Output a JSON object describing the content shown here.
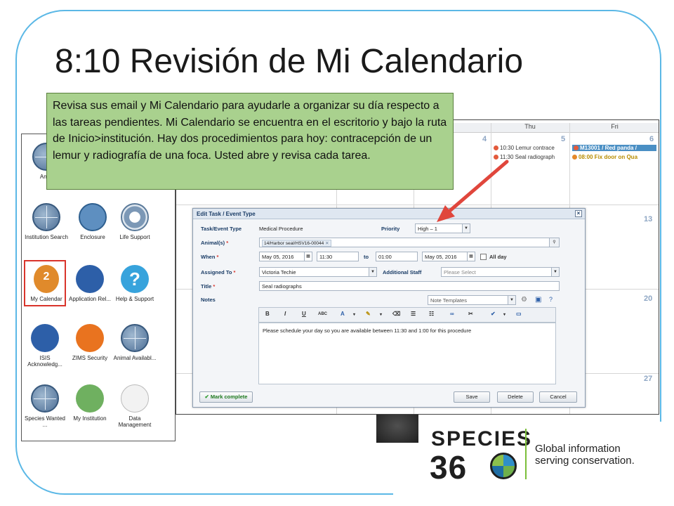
{
  "slide": {
    "title": "8:10 Revisión de Mi Calendario",
    "callout_text": "Revisa sus email y Mi Calendario para ayudarle a organizar su día respecto a las tareas pendientes. Mi Calendario se encuentra en el escritorio y bajo la ruta de Inicio>institución.  Hay dos procedimientos para hoy: contracepción de un lemur y radiografía de una foca. Usted abre y revisa cada tarea."
  },
  "colors": {
    "frame": "#5bb8e6",
    "callout_bg": "#a9d18e",
    "highlight_border": "#d9342b",
    "arrow": "#e0463c",
    "logo_bar": "#7bbf3a"
  },
  "desktop_icons": [
    {
      "label": "Anim",
      "icon": "globe-icon"
    },
    {
      "label": "Institution Search",
      "icon": "globe-icon"
    },
    {
      "label": "Enclosure",
      "icon": "enclosure-icon"
    },
    {
      "label": "Life Support",
      "icon": "life-support-icon"
    },
    {
      "label": "My Calendar",
      "icon": "calendar-icon"
    },
    {
      "label": "Application Rel...",
      "icon": "word-icon"
    },
    {
      "label": "Help & Support",
      "icon": "help-icon"
    },
    {
      "label": "ISIS Acknowledg...",
      "icon": "word-icon"
    },
    {
      "label": "ZIMS Security",
      "icon": "lock-icon"
    },
    {
      "label": "Animal Availabl...",
      "icon": "globe-icon"
    },
    {
      "label": "Species Wanted ...",
      "icon": "globe-icon"
    },
    {
      "label": "My Institution",
      "icon": "house-icon"
    },
    {
      "label": "Data Management",
      "icon": "data-management-icon"
    }
  ],
  "calendar": {
    "day_headers": [
      "d",
      "Thu",
      "Fri"
    ],
    "day_numbers": [
      "4",
      "5",
      "6",
      "13",
      "20",
      "27"
    ],
    "thu_icon_text": "2",
    "events": [
      {
        "text": "10:30 Lemur contrace"
      },
      {
        "text": "11:30 Seal radiograph"
      },
      {
        "text": "M13001 / Red panda /"
      },
      {
        "text": "08:00 Fix door on Qua"
      }
    ]
  },
  "dialog": {
    "title": "Edit Task / Event Type",
    "close_glyph": "×",
    "labels": {
      "task_type": "Task/Event Type",
      "priority": "Priority",
      "animals": "Animal(s)",
      "when": "When",
      "to": "to",
      "all_day": "All day",
      "assigned_to": "Assigned To",
      "additional_staff": "Additional Staff",
      "title": "Title",
      "notes": "Notes",
      "required": "*"
    },
    "values": {
      "task_type": "Medical Procedure",
      "priority": "High – 1",
      "animal_chip": "14/Harbor seal/HSV16-00044",
      "start_date": "May 05, 2016",
      "start_time": "11:30",
      "end_time": "01:00",
      "end_date": "May 05, 2016",
      "assigned_to": "Victoria Techie",
      "additional_staff_placeholder": "Please Select",
      "title": "Seal radiographs",
      "note_templates": "Note Templates",
      "notes_body": "Please schedule your day so you are available between 11:30 and 1:00 for this procedure"
    },
    "toolbar": [
      "B",
      "I",
      "U",
      "ABC",
      "A",
      "▾",
      "✎",
      "▾",
      "⌫",
      "☰",
      "☷",
      "∞",
      "✂",
      "✔",
      "▾",
      "▭"
    ],
    "buttons": {
      "mark_complete": "Mark complete",
      "save": "Save",
      "delete": "Delete",
      "cancel": "Cancel"
    }
  },
  "logo": {
    "word": "SPECIES",
    "number": "36",
    "tagline_1": "Global information",
    "tagline_2": "serving conservation."
  }
}
